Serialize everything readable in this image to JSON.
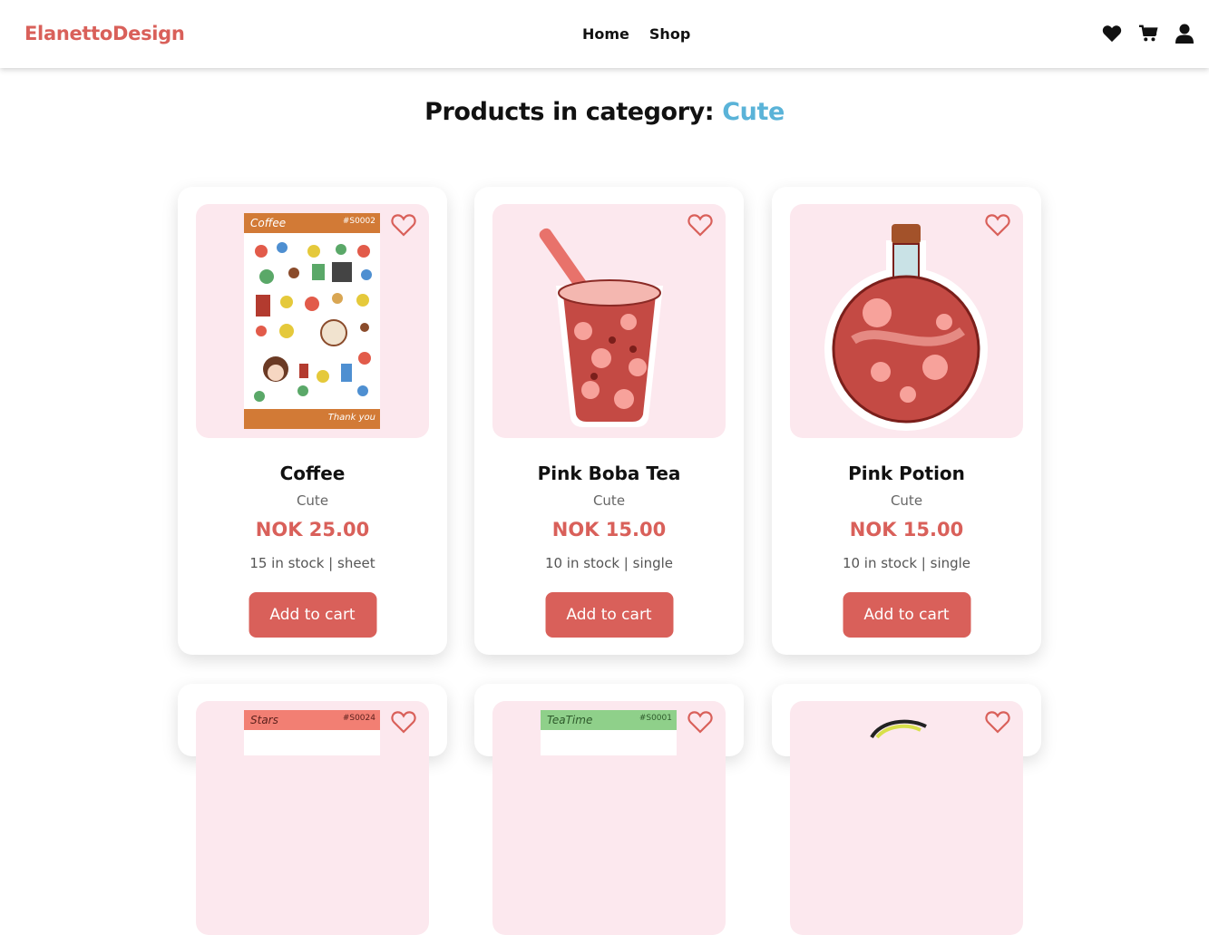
{
  "brand": "ElanettoDesign",
  "nav": {
    "home": "Home",
    "shop": "Shop"
  },
  "icons": [
    "heart-icon",
    "cart-icon",
    "user-icon"
  ],
  "heading": {
    "prefix": "Products in category:",
    "category": "Cute"
  },
  "colors": {
    "accent": "#d9605a",
    "category": "#5ab3d8",
    "thumb_bg": "#fce8ee"
  },
  "products": [
    {
      "name": "Coffee",
      "category": "Cute",
      "price": "NOK 25.00",
      "stock": "15 in stock | sheet",
      "button": "Add to cart",
      "sheet_title": "Coffee",
      "sheet_code": "#S0002",
      "sheet_footer": "Thank you"
    },
    {
      "name": "Pink Boba Tea",
      "category": "Cute",
      "price": "NOK 15.00",
      "stock": "10 in stock | single",
      "button": "Add to cart"
    },
    {
      "name": "Pink Potion",
      "category": "Cute",
      "price": "NOK 15.00",
      "stock": "10 in stock | single",
      "button": "Add to cart"
    }
  ],
  "row2": [
    {
      "sheet_title": "Stars",
      "sheet_code": "#S0024"
    },
    {
      "sheet_title": "TeaTime",
      "sheet_code": "#S0001"
    },
    {}
  ]
}
